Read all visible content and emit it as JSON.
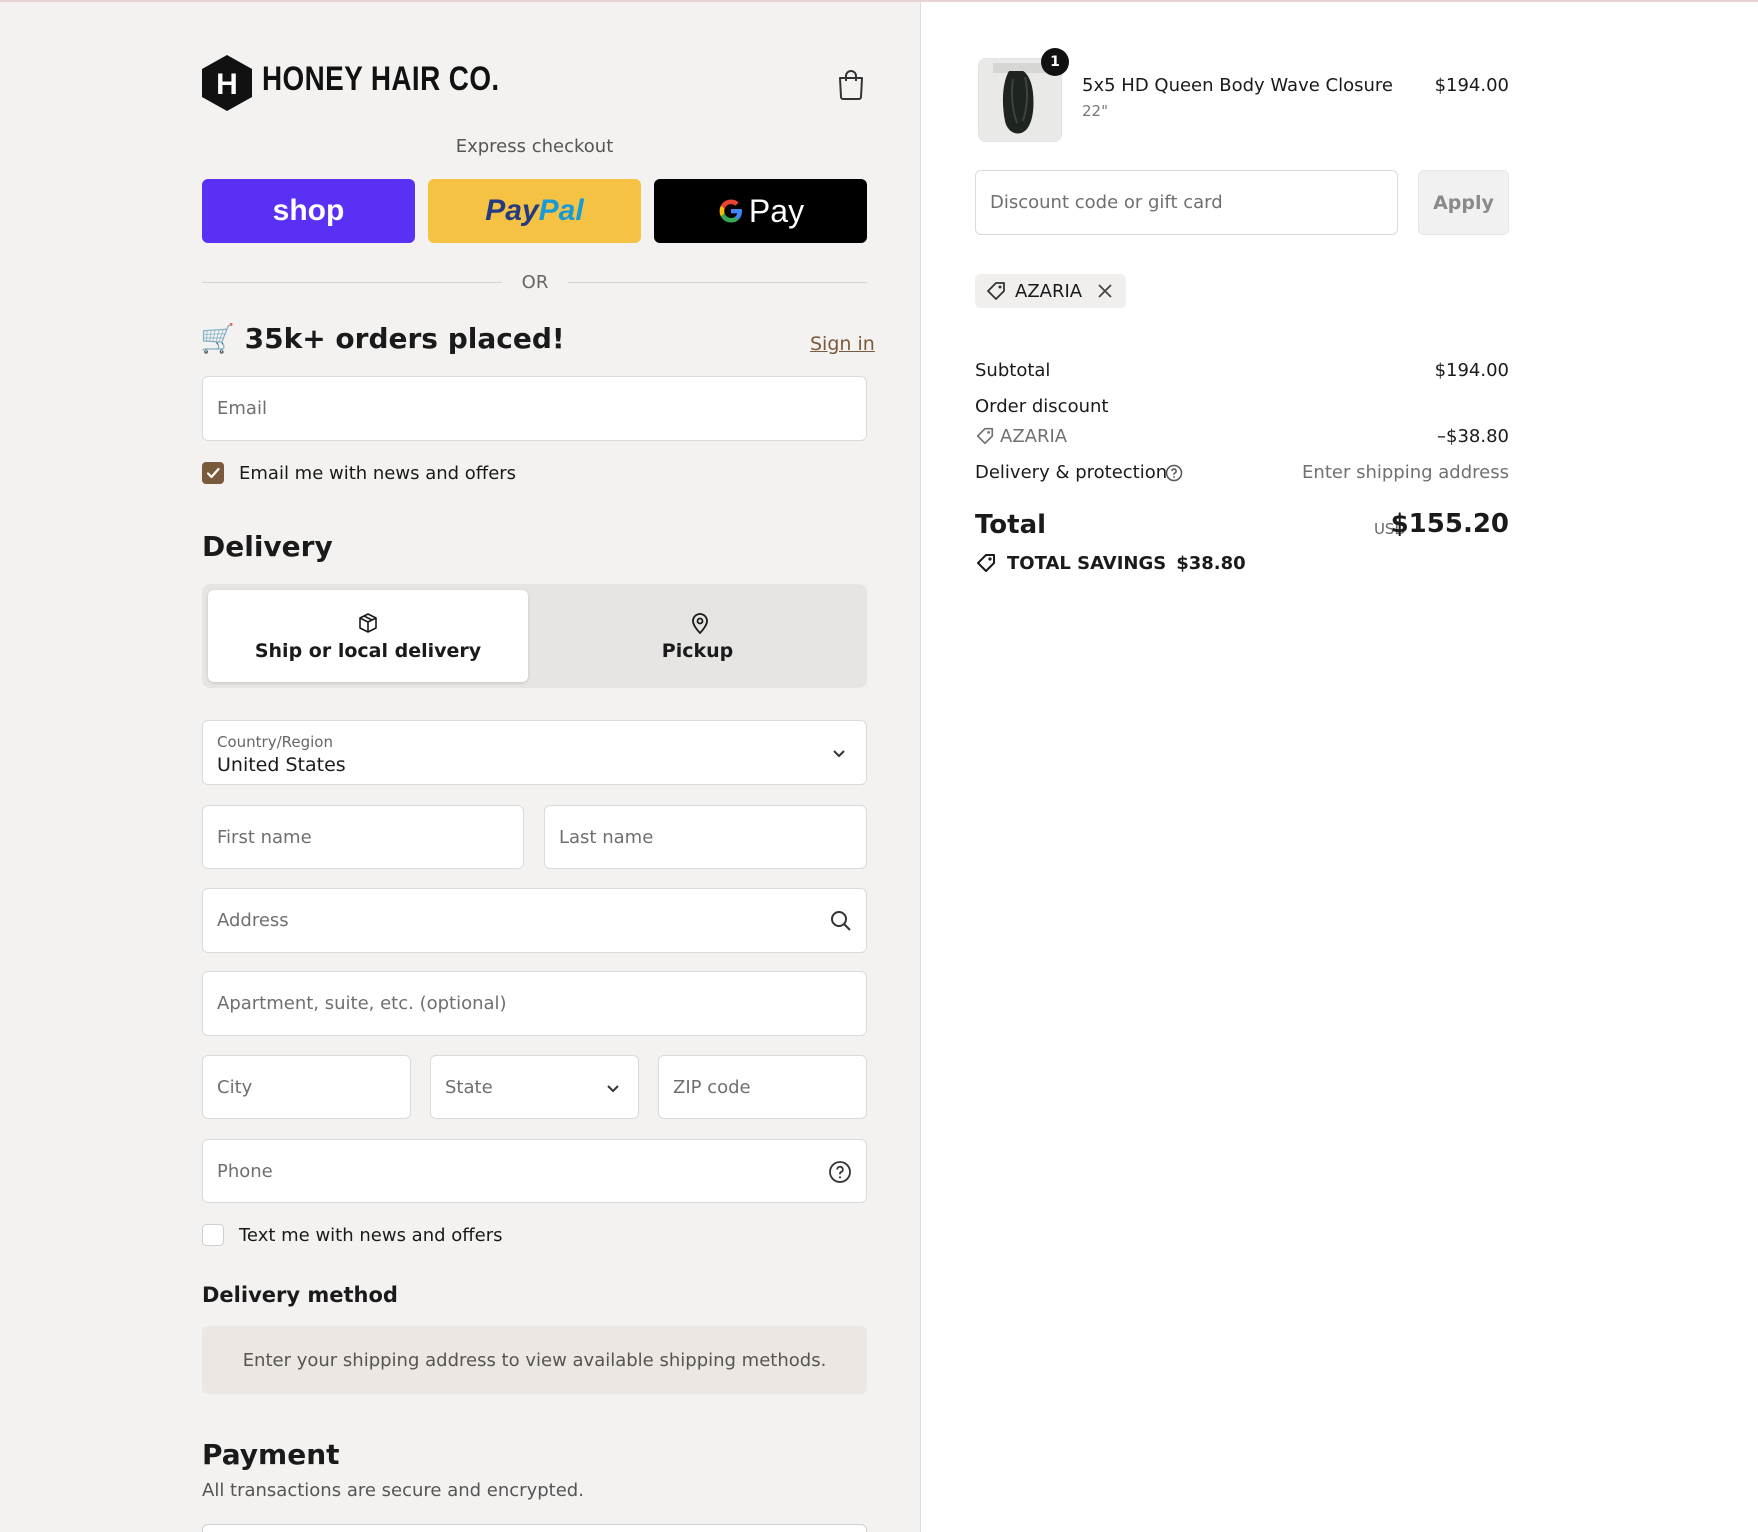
{
  "header": {
    "brand_letter": "H",
    "brand_name": "HONEY HAIR CO."
  },
  "express": {
    "label": "Express checkout",
    "shop_label": "shop",
    "paypal_part1": "Pay",
    "paypal_part2": "Pal",
    "gpay_label": "Pay",
    "or_label": "OR"
  },
  "contact": {
    "headline": "🛒 35k+ orders placed!",
    "sign_in": "Sign in",
    "email_placeholder": "Email",
    "email_news_label": "Email me with news and offers",
    "email_news_checked": true
  },
  "delivery": {
    "title": "Delivery",
    "tabs": [
      {
        "label": "Ship or local delivery",
        "icon": "box-icon",
        "active": true
      },
      {
        "label": "Pickup",
        "icon": "map-pin-icon",
        "active": false
      }
    ],
    "country_label": "Country/Region",
    "country_value": "United States",
    "first_name_placeholder": "First name",
    "last_name_placeholder": "Last name",
    "address_placeholder": "Address",
    "apartment_placeholder": "Apartment, suite, etc. (optional)",
    "city_placeholder": "City",
    "state_placeholder": "State",
    "zip_placeholder": "ZIP code",
    "phone_placeholder": "Phone",
    "text_news_label": "Text me with news and offers",
    "text_news_checked": false
  },
  "delivery_method": {
    "title": "Delivery method",
    "info": "Enter your shipping address to view available shipping methods."
  },
  "payment": {
    "title": "Payment",
    "subtitle": "All transactions are secure and encrypted."
  },
  "order_summary": {
    "item": {
      "quantity": "1",
      "name": "5x5 HD Queen Body Wave Closure",
      "variant": "22\"",
      "price": "$194.00"
    },
    "discount_placeholder": "Discount code or gift card",
    "apply_label": "Apply",
    "applied_code": "AZARIA",
    "subtotal_label": "Subtotal",
    "subtotal_value": "$194.00",
    "order_discount_label": "Order discount",
    "order_discount_code": "AZARIA",
    "order_discount_value": "–$38.80",
    "delivery_label": "Delivery & protection",
    "delivery_value": "Enter shipping address",
    "total_label": "Total",
    "total_currency": "USD",
    "total_value": "$155.20",
    "savings_label": "TOTAL SAVINGS",
    "savings_value": "$38.80"
  },
  "colors": {
    "shop_purple": "#5a31f4",
    "paypal_yellow": "#f5c244",
    "gpay_black": "#000000",
    "accent_brown": "#7a5a3c",
    "left_background": "#f3f2f0"
  }
}
